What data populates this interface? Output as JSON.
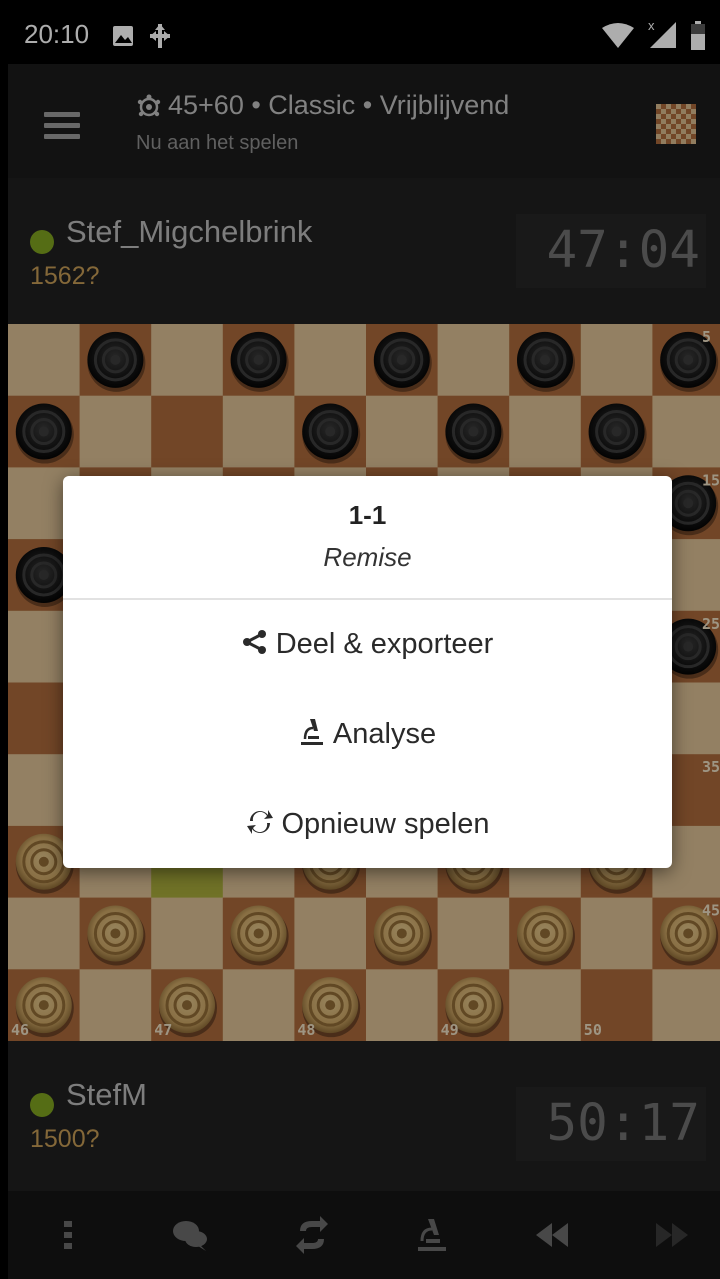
{
  "status_bar": {
    "time": "20:10"
  },
  "header": {
    "title": "45+60 • Classic • Vrijblijvend",
    "subtitle": "Nu aan het spelen"
  },
  "top_player": {
    "name": "Stef_Migchelbrink",
    "rating": "1562?",
    "clock": "47:04"
  },
  "bottom_player": {
    "name": "StefM",
    "rating": "1500?",
    "clock": "50:17"
  },
  "board": {
    "light_square": "#d9bd92",
    "dark_square": "#a8683a",
    "highlight_square": "#a6a83a",
    "notation": [
      "5",
      "15",
      "25",
      "35",
      "45",
      "46",
      "47",
      "48",
      "49",
      "50"
    ]
  },
  "dialog": {
    "score": "1-1",
    "result": "Remise",
    "share_label": "Deel & exporteer",
    "analyse_label": "Analyse",
    "replay_label": "Opnieuw spelen"
  },
  "toolbar": {
    "icons": [
      "more-vertical-icon",
      "chat-icon",
      "flip-board-icon",
      "analysis-icon",
      "rewind-icon",
      "fast-forward-icon"
    ]
  },
  "colors": {
    "online_dot": "#7ea11f",
    "rating": "#c39a54"
  }
}
